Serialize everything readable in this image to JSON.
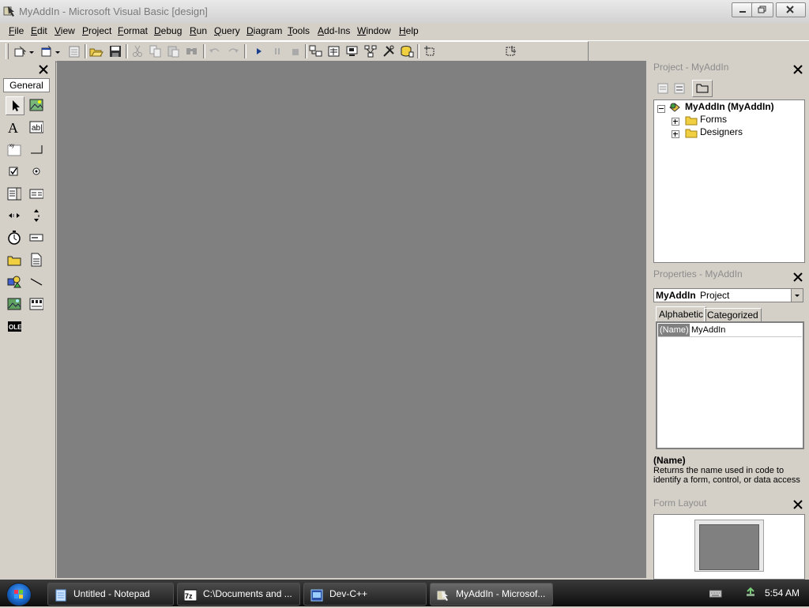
{
  "window": {
    "title": "MyAddIn - Microsoft Visual Basic [design]",
    "app_icon": "vb-app-icon",
    "controls": [
      "minimize-icon",
      "restore-icon",
      "close-icon"
    ]
  },
  "menu": {
    "items": [
      "File",
      "Edit",
      "View",
      "Project",
      "Format",
      "Debug",
      "Run",
      "Query",
      "Diagram",
      "Tools",
      "Add-Ins",
      "Window",
      "Help"
    ]
  },
  "toolbar": {
    "buttons": [
      "add-project-icon",
      "add-form-icon",
      "menu-editor-icon",
      "open-project-icon",
      "save-project-icon",
      "cut-icon",
      "copy-icon",
      "paste-icon",
      "find-icon",
      "undo-icon",
      "redo-icon",
      "start-icon",
      "break-icon",
      "end-icon",
      "project-explorer-icon",
      "properties-window-icon",
      "form-layout-icon",
      "object-browser-icon",
      "toolbox-icon",
      "data-view-icon",
      "component-manager-icon",
      "position-indicator-icon"
    ]
  },
  "toolbox": {
    "tab_label": "General",
    "tools": [
      "pointer-icon",
      "picturebox-icon",
      "label-icon",
      "textbox-icon",
      "frame-icon",
      "commandbutton-icon",
      "checkbox-icon",
      "optionbutton-icon",
      "combobox-icon",
      "listbox-icon",
      "hscrollbar-icon",
      "vscrollbar-icon",
      "timer-icon",
      "drivelistbox-icon",
      "dirlistbox-icon",
      "filelistbox-icon",
      "shape-icon",
      "line-icon",
      "image-icon",
      "data-icon",
      "ole-icon"
    ]
  },
  "project_panel": {
    "title": "Project - MyAddIn",
    "tree": {
      "root": "MyAddIn (MyAddIn)",
      "children": [
        "Forms",
        "Designers"
      ]
    }
  },
  "properties_panel": {
    "title": "Properties - MyAddIn",
    "object_name": "MyAddIn",
    "object_type": "Project",
    "tabs": [
      "Alphabetic",
      "Categorized"
    ],
    "active_tab": "Alphabetic",
    "rows": [
      {
        "name": "(Name)",
        "value": "MyAddIn"
      }
    ],
    "description_title": "(Name)",
    "description_text": "Returns the name used in code to identify a form, control, or data access"
  },
  "form_layout_panel": {
    "title": "Form Layout"
  },
  "taskbar": {
    "buttons": [
      {
        "label": "Untitled - Notepad",
        "icon": "notepad-icon"
      },
      {
        "label": "C:\\Documents and ...",
        "icon": "7zip-icon"
      },
      {
        "label": "Dev-C++",
        "icon": "devcpp-icon"
      },
      {
        "label": "MyAddIn - Microsof...",
        "icon": "vb-app-icon",
        "active": true
      }
    ],
    "clock": "5:54 AM"
  }
}
